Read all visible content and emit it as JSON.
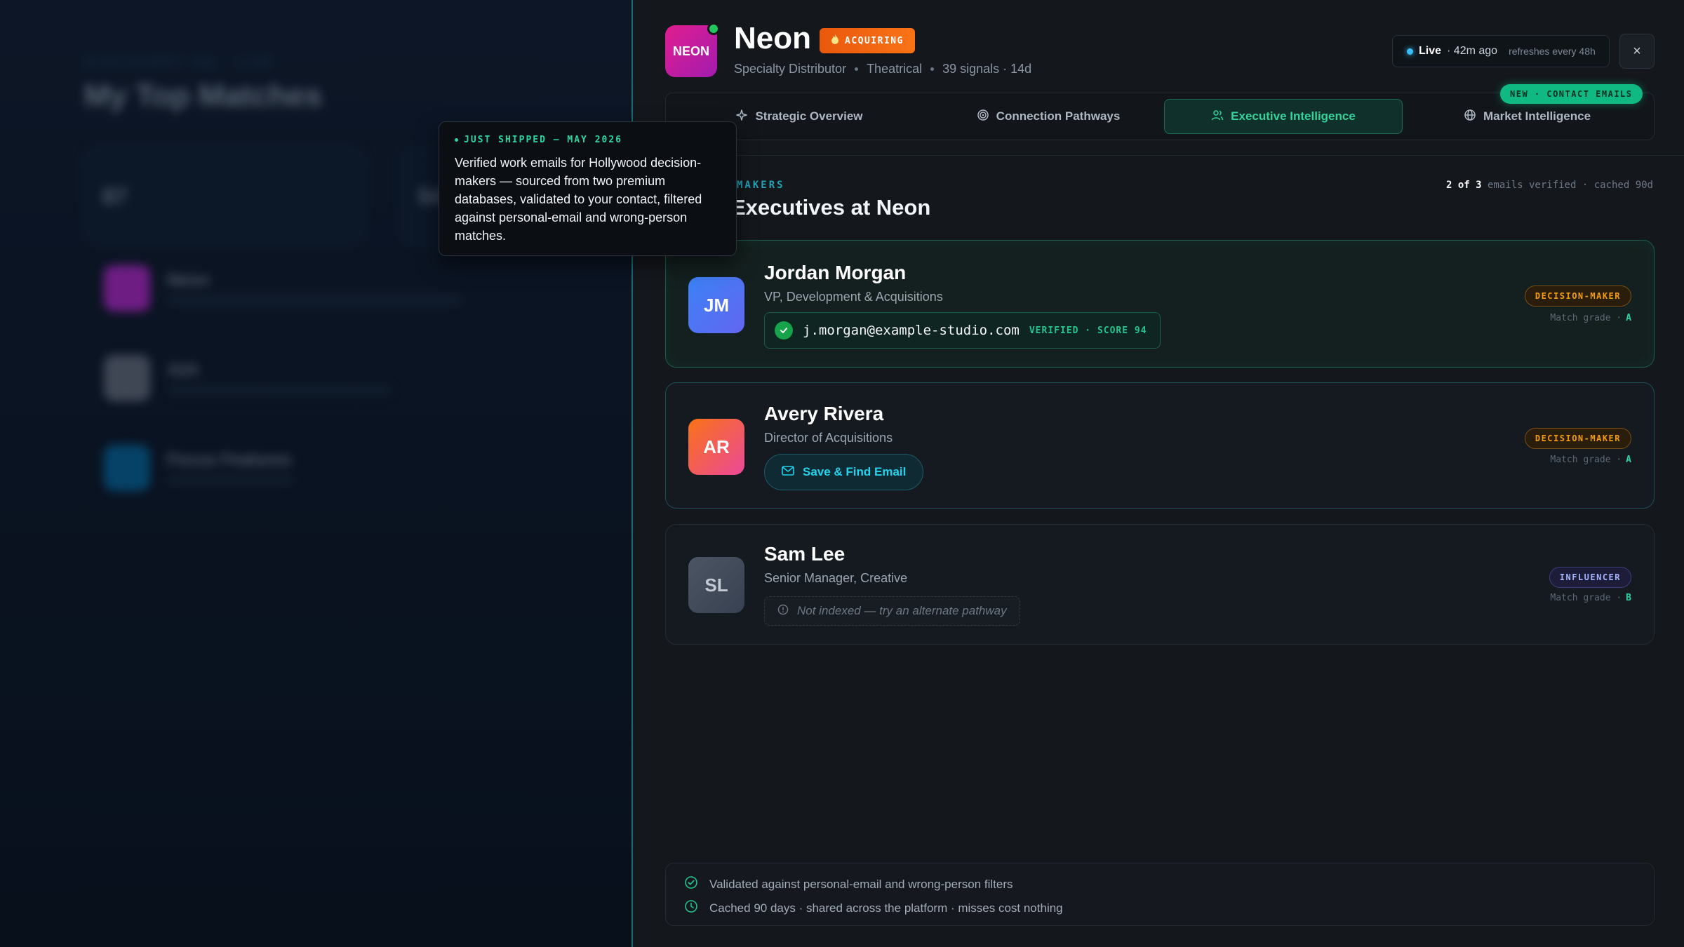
{
  "background": {
    "crumb": "DISCOVERY HQ · LIVE",
    "title": "My Top Matches",
    "stats": [
      {
        "value": "87"
      },
      {
        "value": "54"
      }
    ],
    "rows": [
      {
        "name": "Neon",
        "color": "#c026d3"
      },
      {
        "name": "A24",
        "color": "#6b7280"
      },
      {
        "name": "Focus Features",
        "color": "#0369a1"
      }
    ]
  },
  "tooltip": {
    "kicker": "JUST SHIPPED — MAY 2026",
    "body": "Verified work emails for Hollywood decision-makers — sourced from two premium databases, validated to your contact, filtered against personal-email and wrong-person matches."
  },
  "company": {
    "logo_text": "NEON",
    "name": "Neon",
    "badge": "ACQUIRING",
    "badge_icon": "flame-icon",
    "meta": [
      "Specialty Distributor",
      "Theatrical",
      "39 signals · 14d"
    ]
  },
  "live": {
    "label": "Live",
    "ago": "· 42m ago",
    "refresh": "refreshes every 48h"
  },
  "close_label": "×",
  "tabs": [
    {
      "label": "Strategic Overview",
      "icon": "sparkle-icon"
    },
    {
      "label": "Connection Pathways",
      "icon": "target-icon"
    },
    {
      "label": "Executive Intelligence",
      "icon": "users-icon",
      "active": true
    },
    {
      "label": "Market Intelligence",
      "icon": "globe-icon"
    }
  ],
  "new_badge": "NEW · CONTACT EMAILS",
  "section": {
    "eyebrow": "MAKERS",
    "title": "Executives at Neon",
    "verified_count": "2 of 3",
    "verified_suffix": "emails verified · cached 90d"
  },
  "executives": [
    {
      "initials": "JM",
      "name": "Jordan Morgan",
      "role": "VP, Development & Acquisitions",
      "email": "j.morgan@example-studio.com",
      "email_tag": "VERIFIED · SCORE 94",
      "badge": "DECISION-MAKER",
      "grade_label": "Match grade ·",
      "grade": "A",
      "gradient": [
        "#3b82f6",
        "#6366f1"
      ]
    },
    {
      "initials": "AR",
      "name": "Avery Rivera",
      "role": "Director of Acquisitions",
      "action": "Save & Find Email",
      "badge": "DECISION-MAKER",
      "grade_label": "Match grade ·",
      "grade": "A",
      "gradient": [
        "#f97316",
        "#ec4899"
      ]
    },
    {
      "initials": "SL",
      "name": "Sam Lee",
      "role": "Senior Manager, Creative",
      "status": "Not indexed — try an alternate pathway",
      "badge": "INFLUENCER",
      "grade_label": "Match grade ·",
      "grade": "B",
      "gradient": [
        "#4b5563",
        "#374151"
      ]
    }
  ],
  "footer": [
    "Validated against personal-email and wrong-person filters",
    "Cached 90 days · shared across the platform · misses cost nothing"
  ]
}
